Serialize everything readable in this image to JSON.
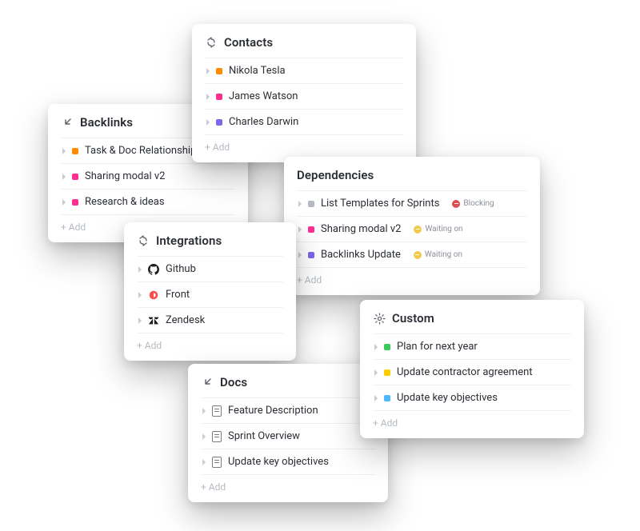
{
  "add_label": "+ Add",
  "colors": {
    "orange": "#ff8c00",
    "pink": "#ff2e93",
    "purple": "#7b68ee",
    "grey": "#b4b9c2",
    "green": "#3cc95b",
    "yellow": "#ffcc00",
    "blue": "#4fb7ff",
    "red": "#e04f4f",
    "amber": "#f3c94b"
  },
  "cards": {
    "backlinks": {
      "title": "Backlinks",
      "items": [
        {
          "label": "Task & Doc Relationships",
          "color": "orange"
        },
        {
          "label": "Sharing modal v2",
          "color": "pink"
        },
        {
          "label": "Research & ideas",
          "color": "pink"
        }
      ]
    },
    "contacts": {
      "title": "Contacts",
      "items": [
        {
          "label": "Nikola Tesla",
          "color": "orange"
        },
        {
          "label": "James Watson",
          "color": "pink"
        },
        {
          "label": "Charles Darwin",
          "color": "purple"
        }
      ]
    },
    "dependencies": {
      "title": "Dependencies",
      "items": [
        {
          "label": "List Templates for Sprints",
          "color": "grey",
          "badge": {
            "text": "Blocking",
            "color": "red"
          }
        },
        {
          "label": "Sharing modal v2",
          "color": "pink",
          "badge": {
            "text": "Waiting on",
            "color": "amber"
          }
        },
        {
          "label": "Backlinks Update",
          "color": "purple",
          "badge": {
            "text": "Waiting on",
            "color": "amber"
          }
        }
      ]
    },
    "integrations": {
      "title": "Integrations",
      "items": [
        {
          "label": "Github",
          "brand": "github"
        },
        {
          "label": "Front",
          "brand": "front"
        },
        {
          "label": "Zendesk",
          "brand": "zendesk"
        }
      ]
    },
    "docs": {
      "title": "Docs",
      "items": [
        {
          "label": "Feature Description"
        },
        {
          "label": "Sprint Overview"
        },
        {
          "label": "Update key objectives"
        }
      ]
    },
    "custom": {
      "title": "Custom",
      "items": [
        {
          "label": "Plan for next year",
          "color": "green"
        },
        {
          "label": "Update contractor agreement",
          "color": "yellow"
        },
        {
          "label": "Update key objectives",
          "color": "blue"
        }
      ]
    }
  }
}
